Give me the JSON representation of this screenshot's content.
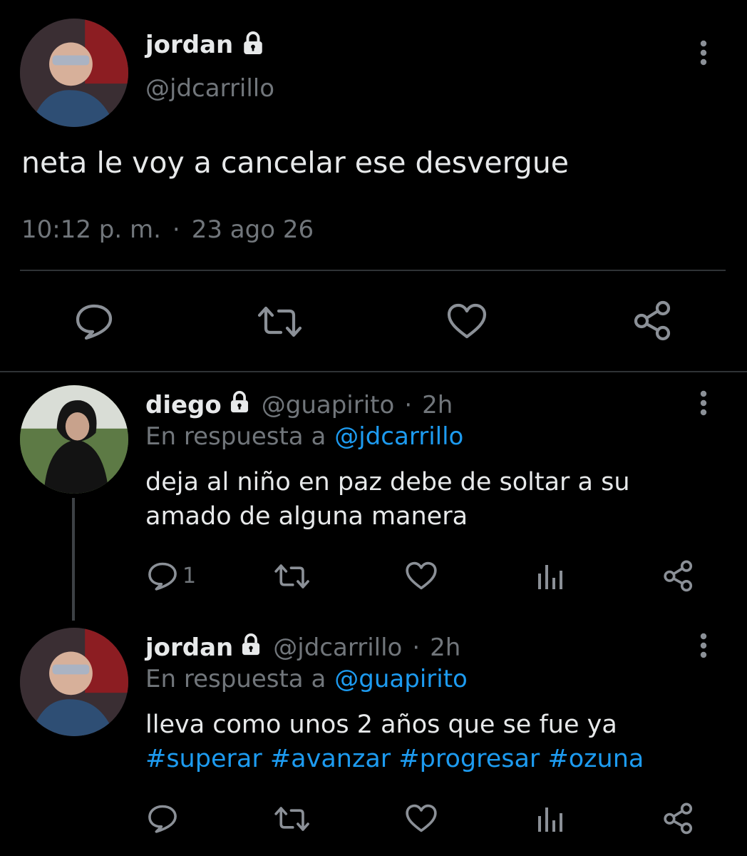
{
  "main_tweet": {
    "name": "jordan",
    "handle": "@jdcarrillo",
    "text": "neta le voy a cancelar ese desvergue",
    "time": "10:12 p. m.",
    "separator": "·",
    "date": "23 ago 26"
  },
  "replies": [
    {
      "name": "diego",
      "handle": "@guapirito",
      "age": "2h",
      "separator": "·",
      "reply_prefix": "En respuesta a",
      "reply_to": "@jdcarrillo",
      "text_line1": "deja al niño en paz debe de soltar a su",
      "text_line2": "amado de alguna manera",
      "reply_count": "1"
    },
    {
      "name": "jordan",
      "handle": "@jdcarrillo",
      "age": "2h",
      "separator": "·",
      "reply_prefix": "En respuesta a",
      "reply_to": "@guapirito",
      "text_line1": "lleva como unos 2 años que se fue ya",
      "hashtags": "#superar #avanzar #progresar #ozuna"
    }
  ],
  "colors": {
    "background": "#000000",
    "text": "#e7e9ea",
    "muted": "#71767b",
    "link": "#1d9bf0",
    "divider": "#2f3336"
  },
  "icons": {
    "lock": "lock-icon",
    "more": "more-vertical-icon",
    "reply": "reply-icon",
    "retweet": "retweet-icon",
    "like": "heart-icon",
    "views": "views-chart-icon",
    "share": "share-icon"
  }
}
